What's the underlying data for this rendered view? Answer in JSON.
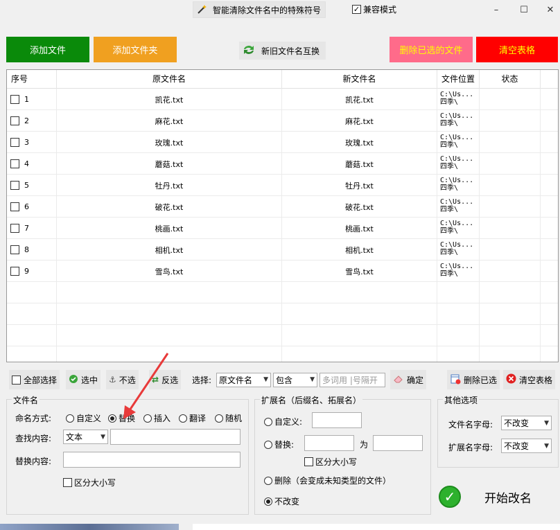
{
  "titlebar": {
    "tool_button_label": "智能清除文件名中的特殊符号",
    "compat_mode_label": "兼容模式",
    "compat_mode_checked": true,
    "minimize_glyph": "–",
    "maximize_glyph": "☐",
    "close_glyph": "✕"
  },
  "top_buttons": {
    "add_file": "添加文件",
    "add_folder": "添加文件夹",
    "swap_names": "新旧文件名互换",
    "delete_selected": "删除已选的文件",
    "clear_table": "清空表格"
  },
  "colors": {
    "add_file_bg": "#0a8a0a",
    "add_folder_bg": "#f0a020",
    "delete_selected_bg": "#ff6b8a",
    "clear_table_bg": "#ff0000",
    "delete_selected_fg": "#ffff00",
    "clear_table_fg": "#ffff00"
  },
  "table": {
    "headers": [
      "序号",
      "原文件名",
      "新文件名",
      "文件位置",
      "状态"
    ],
    "rows": [
      {
        "no": "1",
        "orig": "凯花.txt",
        "new": "凯花.txt",
        "loc1": "C:\\Us...",
        "loc2": "四季\\",
        "status": ""
      },
      {
        "no": "2",
        "orig": "麻花.txt",
        "new": "麻花.txt",
        "loc1": "C:\\Us...",
        "loc2": "四季\\",
        "status": ""
      },
      {
        "no": "3",
        "orig": "玫瑰.txt",
        "new": "玫瑰.txt",
        "loc1": "C:\\Us...",
        "loc2": "四季\\",
        "status": ""
      },
      {
        "no": "4",
        "orig": "蘑菇.txt",
        "new": "蘑菇.txt",
        "loc1": "C:\\Us...",
        "loc2": "四季\\",
        "status": ""
      },
      {
        "no": "5",
        "orig": "牡丹.txt",
        "new": "牡丹.txt",
        "loc1": "C:\\Us...",
        "loc2": "四季\\",
        "status": ""
      },
      {
        "no": "6",
        "orig": "破花.txt",
        "new": "破花.txt",
        "loc1": "C:\\Us...",
        "loc2": "四季\\",
        "status": ""
      },
      {
        "no": "7",
        "orig": "桃画.txt",
        "new": "桃画.txt",
        "loc1": "C:\\Us...",
        "loc2": "四季\\",
        "status": ""
      },
      {
        "no": "8",
        "orig": "相机.txt",
        "new": "相机.txt",
        "loc1": "C:\\Us...",
        "loc2": "四季\\",
        "status": ""
      },
      {
        "no": "9",
        "orig": "雪鸟.txt",
        "new": "雪鸟.txt",
        "loc1": "C:\\Us...",
        "loc2": "四季\\",
        "status": ""
      }
    ]
  },
  "toolbar": {
    "select_all": "全部选择",
    "select": "选中",
    "deselect": "不选",
    "invert": "反选",
    "choose_label": "选择:",
    "field_select": "原文件名",
    "match_select": "包含",
    "keyword_placeholder": "多词用 |号隔开",
    "confirm": "确定",
    "delete_selected": "删除已选",
    "clear_table": "清空表格"
  },
  "filename_group": {
    "title": "文件名",
    "mode_label": "命名方式:",
    "modes": [
      "自定义",
      "替换",
      "插入",
      "翻译",
      "随机"
    ],
    "selected_mode": "替换",
    "find_label": "查找内容:",
    "find_type": "文本",
    "find_value": "",
    "replace_label": "替换内容:",
    "replace_value": "",
    "case_label": "区分大小写"
  },
  "ext_group": {
    "title": "扩展名（后缀名、拓展名）",
    "custom_label": "自定义:",
    "replace_label": "替换:",
    "replace_to": "为",
    "case_label": "区分大小写",
    "delete_label": "删除（会变成未知类型的文件）",
    "nochange_label": "不改变",
    "selected": "不改变"
  },
  "other_group": {
    "title": "其他选项",
    "filename_case_label": "文件名字母:",
    "filename_case_value": "不改变",
    "ext_case_label": "扩展名字母:",
    "ext_case_value": "不改变"
  },
  "start_button": "开始改名"
}
